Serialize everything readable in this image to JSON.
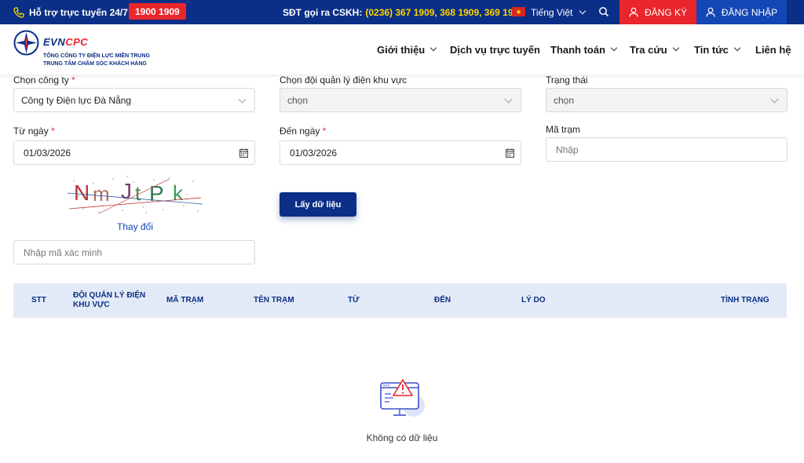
{
  "topbar": {
    "support_label": "Hỗ trợ trực tuyến 24/7:",
    "hotline": "1900 1909",
    "cskh_label": "SĐT gọi ra CSKH:",
    "cskh_numbers": "(0236) 367 1909, 368 1909, 369 1909",
    "language": "Tiếng Việt",
    "register_label": "ĐĂNG KÝ",
    "login_label": "ĐĂNG NHẬP",
    "colors": {
      "bar": "#0b2f87",
      "register": "#e8262b",
      "login": "#1446b5",
      "highlight": "#ffd400"
    }
  },
  "header": {
    "logo_evn": "EVN",
    "logo_cpc": "CPC",
    "logo_sub1": "TỔNG CÔNG TY ĐIỆN LỰC MIỀN TRUNG",
    "logo_sub2": "TRUNG TÂM CHĂM SÓC KHÁCH HÀNG",
    "nav": [
      {
        "label": "Giới thiệu",
        "has_dropdown": true
      },
      {
        "label": "Dịch vụ trực tuyến",
        "has_dropdown": false
      },
      {
        "label": "Thanh toán",
        "has_dropdown": true
      },
      {
        "label": "Tra cứu",
        "has_dropdown": true
      },
      {
        "label": "Tin tức",
        "has_dropdown": true
      },
      {
        "label": "Liên hệ",
        "has_dropdown": false
      }
    ]
  },
  "form": {
    "company": {
      "label": "Chọn công ty",
      "required_mark": "*",
      "value": "Công ty Điện lực Đà Nẵng"
    },
    "team": {
      "label": "Chọn đội quản lý điện khu vực",
      "value": "chọn"
    },
    "status": {
      "label": "Trạng thái",
      "value": "chọn"
    },
    "from_date": {
      "label": "Từ ngày",
      "required_mark": "*",
      "value": "01/03/2026"
    },
    "to_date": {
      "label": "Đến ngày",
      "required_mark": "*",
      "value": "01/03/2026"
    },
    "station_code": {
      "label": "Mã trạm",
      "placeholder": "Nhập"
    },
    "captcha_text": "NmJtPk",
    "captcha_change": "Thay đổi",
    "captcha_input_placeholder": "Nhập mã xác minh",
    "submit_label": "Lấy dữ liệu"
  },
  "table": {
    "columns": [
      "STT",
      "ĐỘI QUẢN LÝ ĐIỆN KHU VỰC",
      "MÃ TRẠM",
      "TÊN TRẠM",
      "TỪ",
      "ĐẾN",
      "LÝ DO",
      "TÌNH TRẠNG"
    ],
    "col_team_line1": "ĐỘI QUẢN LÝ ĐIỆN",
    "col_team_line2": "KHU VỰC",
    "rows": [],
    "empty_text": "Không có dữ liệu"
  },
  "icons": {
    "phone": "phone-icon",
    "search": "search-icon",
    "user": "user-icon",
    "calendar": "calendar-icon",
    "empty": "no-data-warning-icon"
  }
}
